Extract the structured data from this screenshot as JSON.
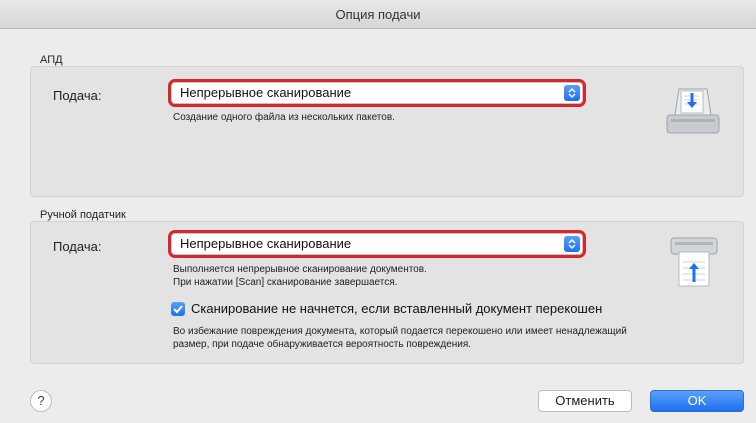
{
  "window": {
    "title": "Опция подачи"
  },
  "adf": {
    "section_label": "АПД",
    "feed_label": "Подача:",
    "feed_value": "Непрерывное сканирование",
    "description": "Создание одного файла из нескольких пакетов."
  },
  "manual": {
    "section_label": "Ручной податчик",
    "feed_label": "Подача:",
    "feed_value": "Непрерывное сканирование",
    "description_line1": "Выполняется непрерывное сканирование документов.",
    "description_line2": "При нажатии [Scan] сканирование завершается.",
    "skew_checkbox": {
      "checked": true,
      "label": "Сканирование не начнется, если вставленный документ перекошен"
    },
    "skew_note_line1": "Во избежание повреждения документа, который подается перекошено или имеет ненадлежащий",
    "skew_note_line2": "размер, при подаче обнаруживается вероятность повреждения."
  },
  "footer": {
    "help_label": "?",
    "cancel_label": "Отменить",
    "ok_label": "OK"
  },
  "colors": {
    "accent": "#1f6ff0",
    "highlight_ring": "#d9262b"
  }
}
